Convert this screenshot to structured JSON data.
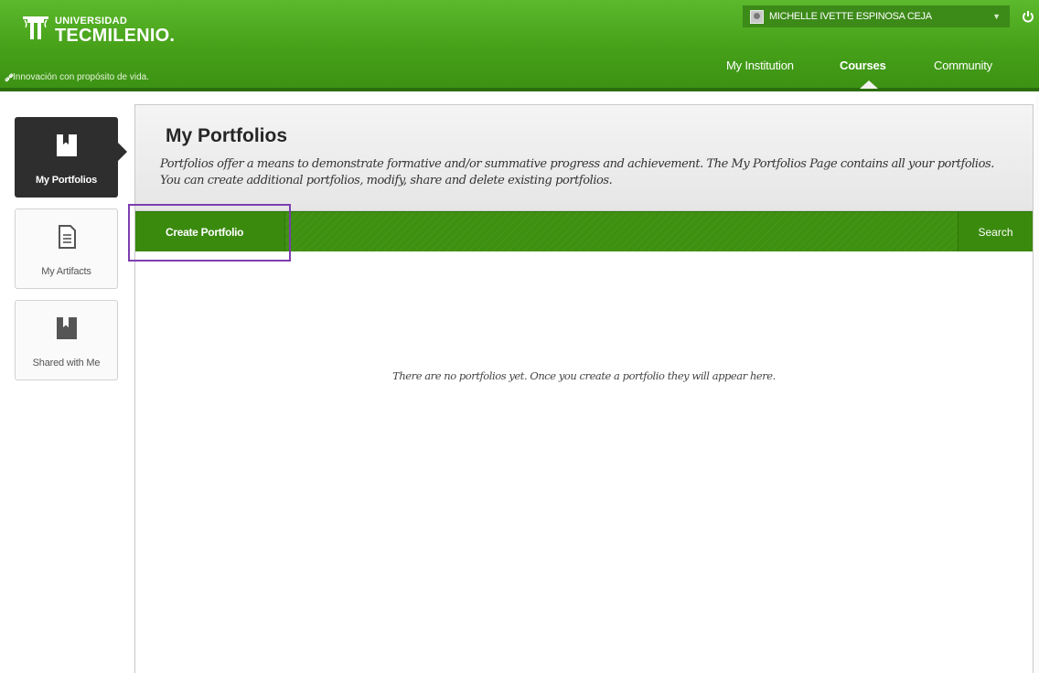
{
  "brand": {
    "top_line": "UNIVERSIDAD",
    "name": "TECMILENIO.",
    "tagline": "Innovación con propósito de vida."
  },
  "user": {
    "name": "MICHELLE IVETTE ESPINOSA CEJA"
  },
  "nav": {
    "items": [
      {
        "label": "My Institution"
      },
      {
        "label": "Courses",
        "active": true
      },
      {
        "label": "Community"
      }
    ]
  },
  "sidebar": {
    "items": [
      {
        "label": "My Portfolios",
        "icon": "portfolio-icon",
        "active": true
      },
      {
        "label": "My Artifacts",
        "icon": "document-icon"
      },
      {
        "label": "Shared with Me",
        "icon": "bookmark-icon"
      }
    ]
  },
  "page": {
    "title": "My Portfolios",
    "description": "Portfolios offer a means to demonstrate formative and/or summative progress and achievement. The My Portfolios Page contains all your portfolios. You can create additional portfolios, modify, share and delete existing portfolios."
  },
  "toolbar": {
    "create_label": "Create Portfolio",
    "search_label": "Search"
  },
  "content": {
    "empty_message": "There are no portfolios yet. Once you create a portfolio they will appear here."
  },
  "colors": {
    "header_green": "#46a119",
    "toolbar_green": "#3e9011",
    "active_sidebar": "#2e2e2e",
    "highlight_purple": "#7d3eb0"
  }
}
